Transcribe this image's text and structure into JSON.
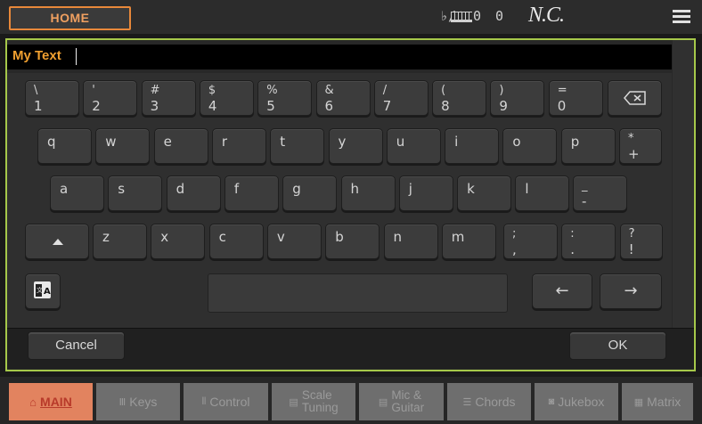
{
  "topbar": {
    "home_label": "HOME",
    "key_signature_label": "♭/♯:",
    "key_signature_value": "0",
    "keyboard_value": "0",
    "chord": "N.C."
  },
  "text_field": {
    "value": "My Text"
  },
  "keyboard": {
    "row1": [
      {
        "top": "\\",
        "bot": "1"
      },
      {
        "top": "'",
        "bot": "2"
      },
      {
        "top": "#",
        "bot": "3"
      },
      {
        "top": "$",
        "bot": "4"
      },
      {
        "top": "%",
        "bot": "5"
      },
      {
        "top": "&",
        "bot": "6"
      },
      {
        "top": "/",
        "bot": "7"
      },
      {
        "top": "(",
        "bot": "8"
      },
      {
        "top": ")",
        "bot": "9"
      },
      {
        "top": "=",
        "bot": "0"
      }
    ],
    "row2": [
      "q",
      "w",
      "e",
      "r",
      "t",
      "y",
      "u",
      "i",
      "o",
      "p"
    ],
    "row2_special": {
      "top": "*",
      "bot": "+"
    },
    "row3": [
      "a",
      "s",
      "d",
      "f",
      "g",
      "h",
      "j",
      "k",
      "l"
    ],
    "row3_special": {
      "top": "_",
      "bot": "-"
    },
    "row4": [
      "z",
      "x",
      "c",
      "v",
      "b",
      "n",
      "m"
    ],
    "row4_specials": [
      {
        "top": ";",
        "bot": ","
      },
      {
        "top": ":",
        "bot": "."
      },
      {
        "top": "?",
        "bot": "!"
      }
    ],
    "arrow_left": "←",
    "arrow_right": "→"
  },
  "dialog": {
    "cancel_label": "Cancel",
    "ok_label": "OK"
  },
  "tabs": [
    {
      "icon": "⌂",
      "label": "MAIN"
    },
    {
      "icon": "Ⅲ",
      "label": "Keys"
    },
    {
      "icon": "⦀",
      "label": "Control"
    },
    {
      "icon": "▤",
      "label": "Scale",
      "label2": "Tuning"
    },
    {
      "icon": "▤",
      "label": "Mic &",
      "label2": "Guitar"
    },
    {
      "icon": "☰",
      "label": "Chords"
    },
    {
      "icon": "◙",
      "label": "Jukebox"
    },
    {
      "icon": "▦",
      "label": "Matrix"
    }
  ],
  "colors": {
    "accent": "#e8883a",
    "frame": "#a6c84a",
    "text_value": "#f0a030",
    "active_tab": "#e2835f"
  }
}
